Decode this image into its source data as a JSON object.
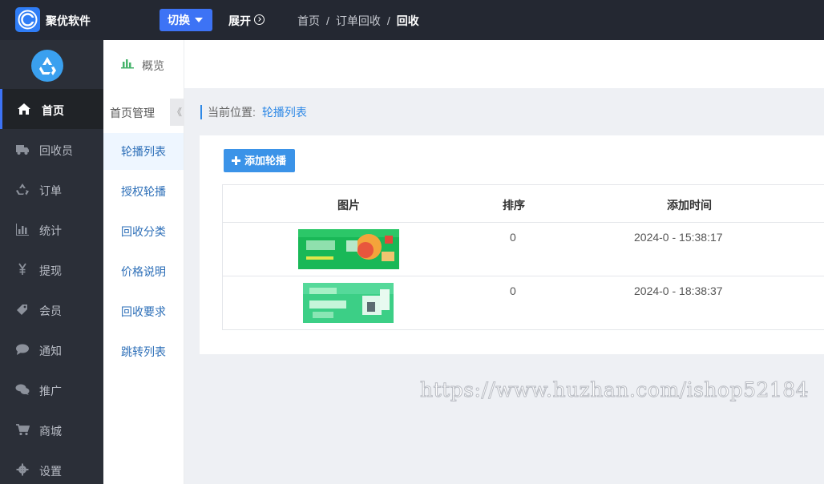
{
  "topbar": {
    "brand": "聚优软件",
    "switch_label": "切换",
    "expand_label": "展开",
    "breadcrumb": [
      "首页",
      "订单回收",
      "回收"
    ],
    "separator": "/"
  },
  "sidebar": {
    "items": [
      {
        "label": "首页",
        "icon": "home-icon",
        "active": true
      },
      {
        "label": "回收员",
        "icon": "truck-icon",
        "active": false
      },
      {
        "label": "订单",
        "icon": "recycle-icon",
        "active": false
      },
      {
        "label": "统计",
        "icon": "bar-chart-icon",
        "active": false
      },
      {
        "label": "提现",
        "icon": "yen-icon",
        "active": false
      },
      {
        "label": "会员",
        "icon": "tag-icon",
        "active": false
      },
      {
        "label": "通知",
        "icon": "chat-icon",
        "active": false
      },
      {
        "label": "推广",
        "icon": "comments-icon",
        "active": false
      },
      {
        "label": "商城",
        "icon": "cart-icon",
        "active": false
      },
      {
        "label": "设置",
        "icon": "gear-icon",
        "active": false
      }
    ]
  },
  "subnav": {
    "overview": "概览",
    "section_title": "首页管理",
    "collapse_glyph": "《",
    "items": [
      {
        "label": "轮播列表",
        "active": true
      },
      {
        "label": "授权轮播",
        "active": false
      },
      {
        "label": "回收分类",
        "active": false
      },
      {
        "label": "价格说明",
        "active": false
      },
      {
        "label": "回收要求",
        "active": false
      },
      {
        "label": "跳转列表",
        "active": false
      }
    ]
  },
  "location": {
    "prefix": "当前位置:",
    "current": "轮播列表"
  },
  "toolbar": {
    "add_label": "添加轮播"
  },
  "table": {
    "columns": [
      "图片",
      "排序",
      "添加时间"
    ],
    "rows": [
      {
        "sort": "0",
        "time": "2024-0  -  15:38:17"
      },
      {
        "sort": "0",
        "time": "2024-0  -   18:38:37"
      }
    ]
  },
  "watermark": "https://www.huzhan.com/ishop52184",
  "colors": {
    "topbar": "#242832",
    "sidebar": "#2b2f38",
    "accent": "#3d73f5",
    "link": "#2f89e6"
  }
}
